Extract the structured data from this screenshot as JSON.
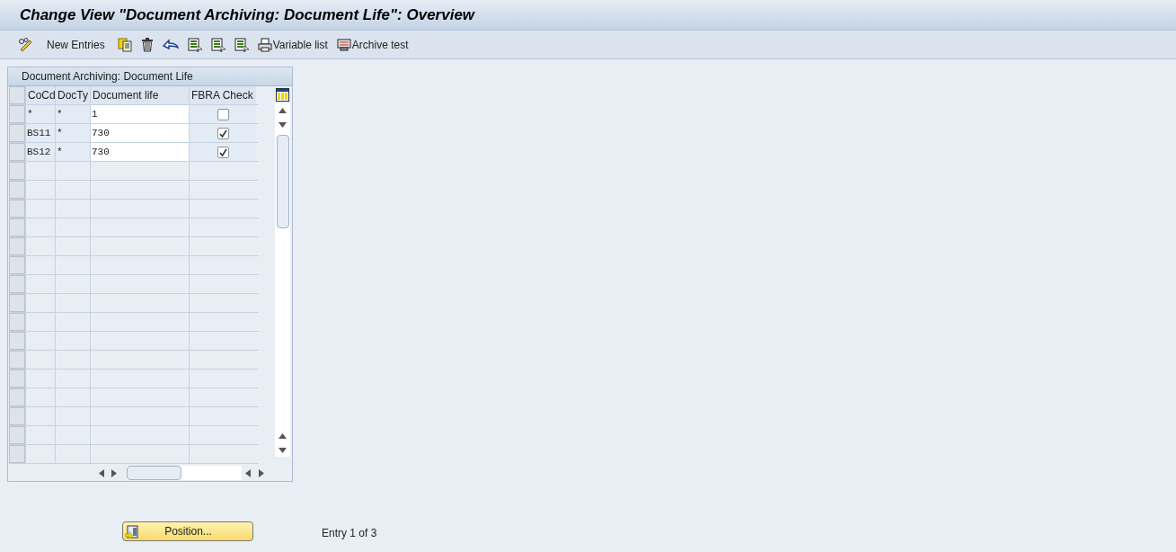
{
  "window": {
    "title": "Change View \"Document Archiving: Document Life\": Overview"
  },
  "toolbar": [
    {
      "kind": "glasses"
    },
    {
      "kind": "text",
      "label": "New Entries"
    },
    {
      "kind": "copy"
    },
    {
      "kind": "delete"
    },
    {
      "kind": "undo"
    },
    {
      "kind": "select"
    },
    {
      "kind": "select"
    },
    {
      "kind": "select"
    },
    {
      "kind": "print",
      "label": "Variable list"
    },
    {
      "kind": "archive",
      "label": "Archive test"
    }
  ],
  "table": {
    "title": "Document Archiving: Document Life",
    "columns": [
      "CoCd",
      "DocTy",
      "Document life",
      "FBRA Check"
    ],
    "rows": [
      {
        "cocd": "*",
        "doc_type": "*",
        "document_life": "1",
        "fbra_check": false
      },
      {
        "cocd": "BS11",
        "doc_type": "*",
        "document_life": "730",
        "fbra_check": true
      },
      {
        "cocd": "BS12",
        "doc_type": "*",
        "document_life": "730",
        "fbra_check": true
      }
    ]
  },
  "position_button": "Position...",
  "entry_info": "Entry 1 of 3"
}
